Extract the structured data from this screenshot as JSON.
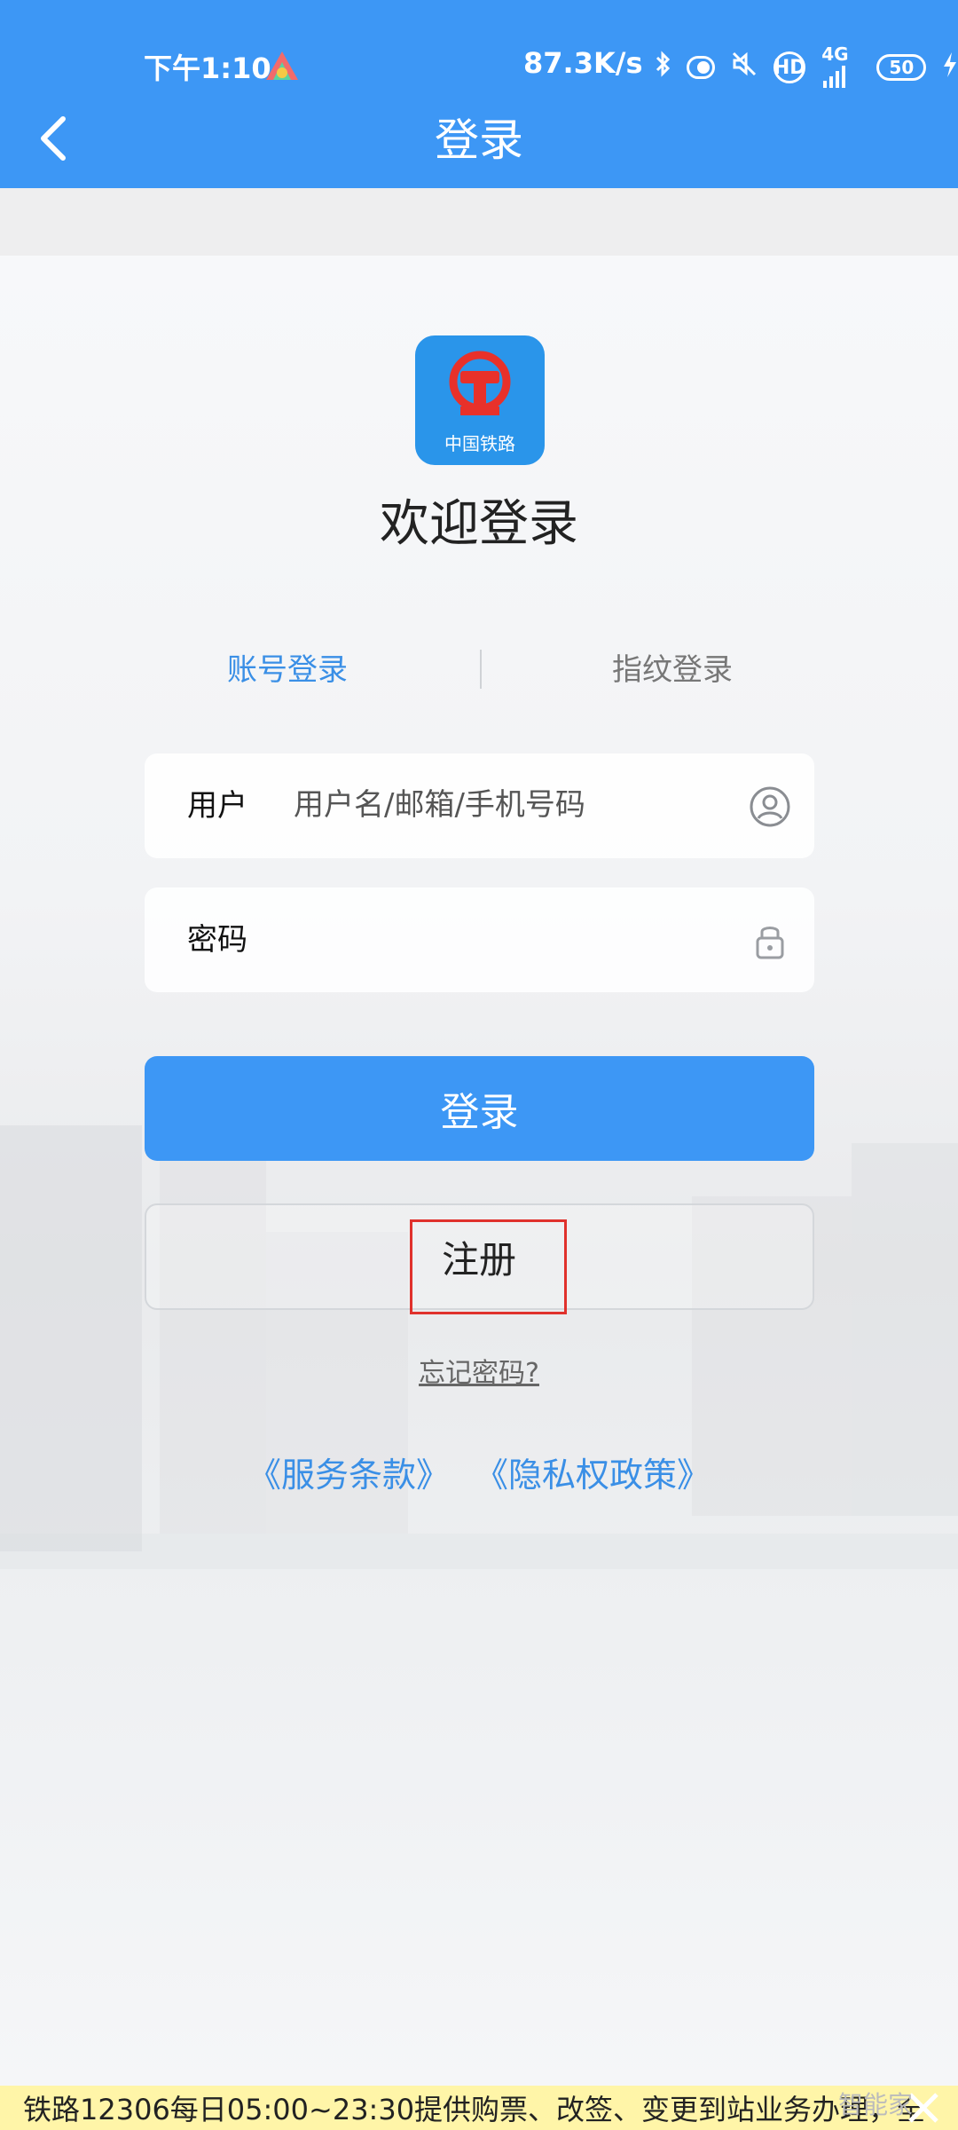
{
  "status_bar": {
    "time": "下午1:10",
    "network_speed": "87.3K/s",
    "signal_label": "4G",
    "hd_label": "HD",
    "battery": "50",
    "icons": [
      "app-icon",
      "bluetooth-icon",
      "toggle-icon",
      "mute-icon",
      "hd-icon",
      "signal-icon",
      "battery-icon",
      "charging-icon"
    ]
  },
  "header": {
    "title": "登录",
    "back_icon": "chevron-left-icon"
  },
  "logo": {
    "caption": "中国铁路",
    "icon": "china-railway-logo"
  },
  "welcome": "欢迎登录",
  "tabs": [
    {
      "label": "账号登录",
      "active": true
    },
    {
      "label": "指纹登录",
      "active": false
    }
  ],
  "form": {
    "user_label": "用户",
    "user_placeholder": "用户名/邮箱/手机号码",
    "user_icon": "user-circle-icon",
    "password_label": "密码",
    "password_placeholder": "",
    "password_icon": "lock-icon"
  },
  "buttons": {
    "login": "登录",
    "register": "注册",
    "forgot": "忘记密码?"
  },
  "legal": {
    "terms": "《服务条款》",
    "privacy": "《隐私权政策》"
  },
  "notice": {
    "text": "铁路12306每日05:00~23:30提供购票、改签、变更到站业务办理，全",
    "close_icon": "close-icon"
  },
  "watermark": "智能家",
  "colors": {
    "primary": "#3d97f5",
    "link": "#3a8fe6",
    "highlight": "#e0312c",
    "notice_bg": "#fff5a8"
  }
}
